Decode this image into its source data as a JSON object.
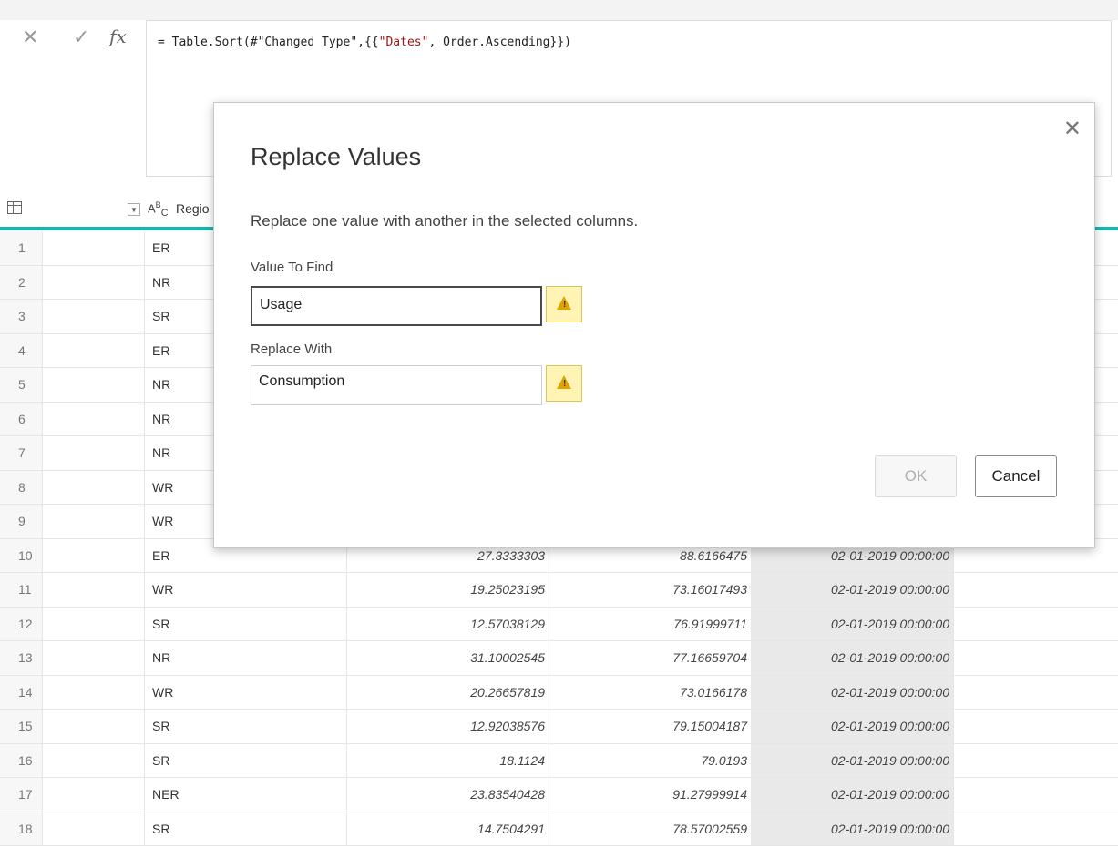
{
  "formula_bar": {
    "cancel_icon": "close-icon",
    "commit_icon": "check-icon",
    "fx_label": "fx",
    "formula_prefix": "= Table.Sort(#\"Changed Type\",{{",
    "formula_string": "\"Dates\"",
    "formula_suffix": ", Order.Ascending}})"
  },
  "grid": {
    "header": {
      "type_label": "A",
      "type_sup": "B",
      "type_sub": "C",
      "column_name": "Regio"
    },
    "rows": [
      {
        "n": "1",
        "region": "ER",
        "v1": "",
        "v2": "",
        "date": "",
        "tail": ""
      },
      {
        "n": "2",
        "region": "NR",
        "v1": "",
        "v2": "",
        "date": "",
        "tail": ""
      },
      {
        "n": "3",
        "region": "SR",
        "v1": "",
        "v2": "",
        "date": "",
        "tail": ""
      },
      {
        "n": "4",
        "region": "ER",
        "v1": "",
        "v2": "",
        "date": "",
        "tail": ""
      },
      {
        "n": "5",
        "region": "NR",
        "v1": "",
        "v2": "",
        "date": "",
        "tail": ""
      },
      {
        "n": "6",
        "region": "NR",
        "v1": "",
        "v2": "",
        "date": "",
        "tail": ""
      },
      {
        "n": "7",
        "region": "NR",
        "v1": "",
        "v2": "",
        "date": "",
        "tail": ""
      },
      {
        "n": "8",
        "region": "WR",
        "v1": "",
        "v2": "",
        "date": "",
        "tail": ""
      },
      {
        "n": "9",
        "region": "WR",
        "v1": "",
        "v2": "",
        "date": "",
        "tail": ""
      },
      {
        "n": "10",
        "region": "ER",
        "v1": "27.3333303",
        "v2": "88.6166475",
        "date": "02-01-2019 00:00:00",
        "tail": ""
      },
      {
        "n": "11",
        "region": "WR",
        "v1": "19.25023195",
        "v2": "73.16017493",
        "date": "02-01-2019 00:00:00",
        "tail": ""
      },
      {
        "n": "12",
        "region": "SR",
        "v1": "12.57038129",
        "v2": "76.91999711",
        "date": "02-01-2019 00:00:00",
        "tail": ""
      },
      {
        "n": "13",
        "region": "NR",
        "v1": "31.10002545",
        "v2": "77.16659704",
        "date": "02-01-2019 00:00:00",
        "tail": ""
      },
      {
        "n": "14",
        "region": "WR",
        "v1": "20.26657819",
        "v2": "73.0166178",
        "date": "02-01-2019 00:00:00",
        "tail": ""
      },
      {
        "n": "15",
        "region": "SR",
        "v1": "12.92038576",
        "v2": "79.15004187",
        "date": "02-01-2019 00:00:00",
        "tail": ""
      },
      {
        "n": "16",
        "region": "SR",
        "v1": "18.1124",
        "v2": "79.0193",
        "date": "02-01-2019 00:00:00",
        "tail": ""
      },
      {
        "n": "17",
        "region": "NER",
        "v1": "23.83540428",
        "v2": "91.27999914",
        "date": "02-01-2019 00:00:00",
        "tail": ""
      },
      {
        "n": "18",
        "region": "SR",
        "v1": "14.7504291",
        "v2": "78.57002559",
        "date": "02-01-2019 00:00:00",
        "tail": ""
      }
    ]
  },
  "dialog": {
    "title": "Replace Values",
    "description": "Replace one value with another in the selected columns.",
    "find_label": "Value To Find",
    "find_value": "Usage",
    "replace_label": "Replace With",
    "replace_value": "Consumption",
    "ok_label": "OK",
    "cancel_label": "Cancel",
    "close_glyph": "✕"
  }
}
